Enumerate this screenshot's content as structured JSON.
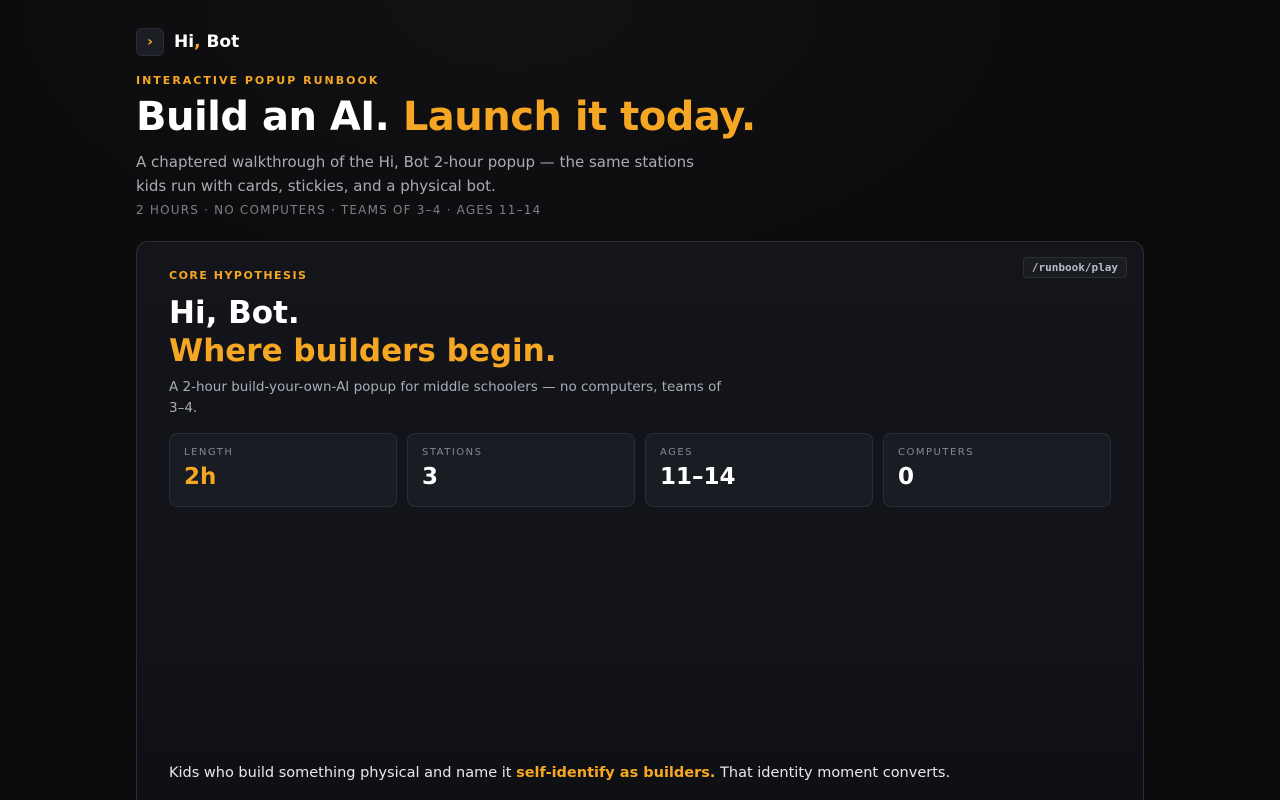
{
  "brand": {
    "mark": "›",
    "name_part1": "Hi",
    "name_comma": ",",
    "name_part2": " Bot"
  },
  "hero": {
    "eyebrow": "INTERACTIVE POPUP RUNBOOK",
    "title_main": "Build an AI. ",
    "title_accent": "Launch it today.",
    "subtitle": "A chaptered walkthrough of the Hi, Bot 2-hour popup — the same stations kids run with cards, stickies, and a physical bot.",
    "meta": "2 HOURS · NO COMPUTERS · TEAMS OF 3–4 · AGES 11–14"
  },
  "card": {
    "route": "/runbook/play",
    "eyebrow": "CORE HYPOTHESIS",
    "title_line1": "Hi, Bot.",
    "title_line2": "Where builders begin.",
    "description": "A 2-hour build-your-own-AI popup for middle schoolers — no computers, teams of 3–4.",
    "stats": [
      {
        "label": "LENGTH",
        "value": "2h"
      },
      {
        "label": "STATIONS",
        "value": "3"
      },
      {
        "label": "AGES",
        "value": "11–14"
      },
      {
        "label": "COMPUTERS",
        "value": "0"
      }
    ],
    "tagline_pre": "Kids who build something physical and name it ",
    "tagline_hl": "self-identify as builders.",
    "tagline_post": " That identity moment converts."
  },
  "colors": {
    "accent": "#f5a623",
    "background": "#0b0b0c",
    "card": "#13151b"
  }
}
